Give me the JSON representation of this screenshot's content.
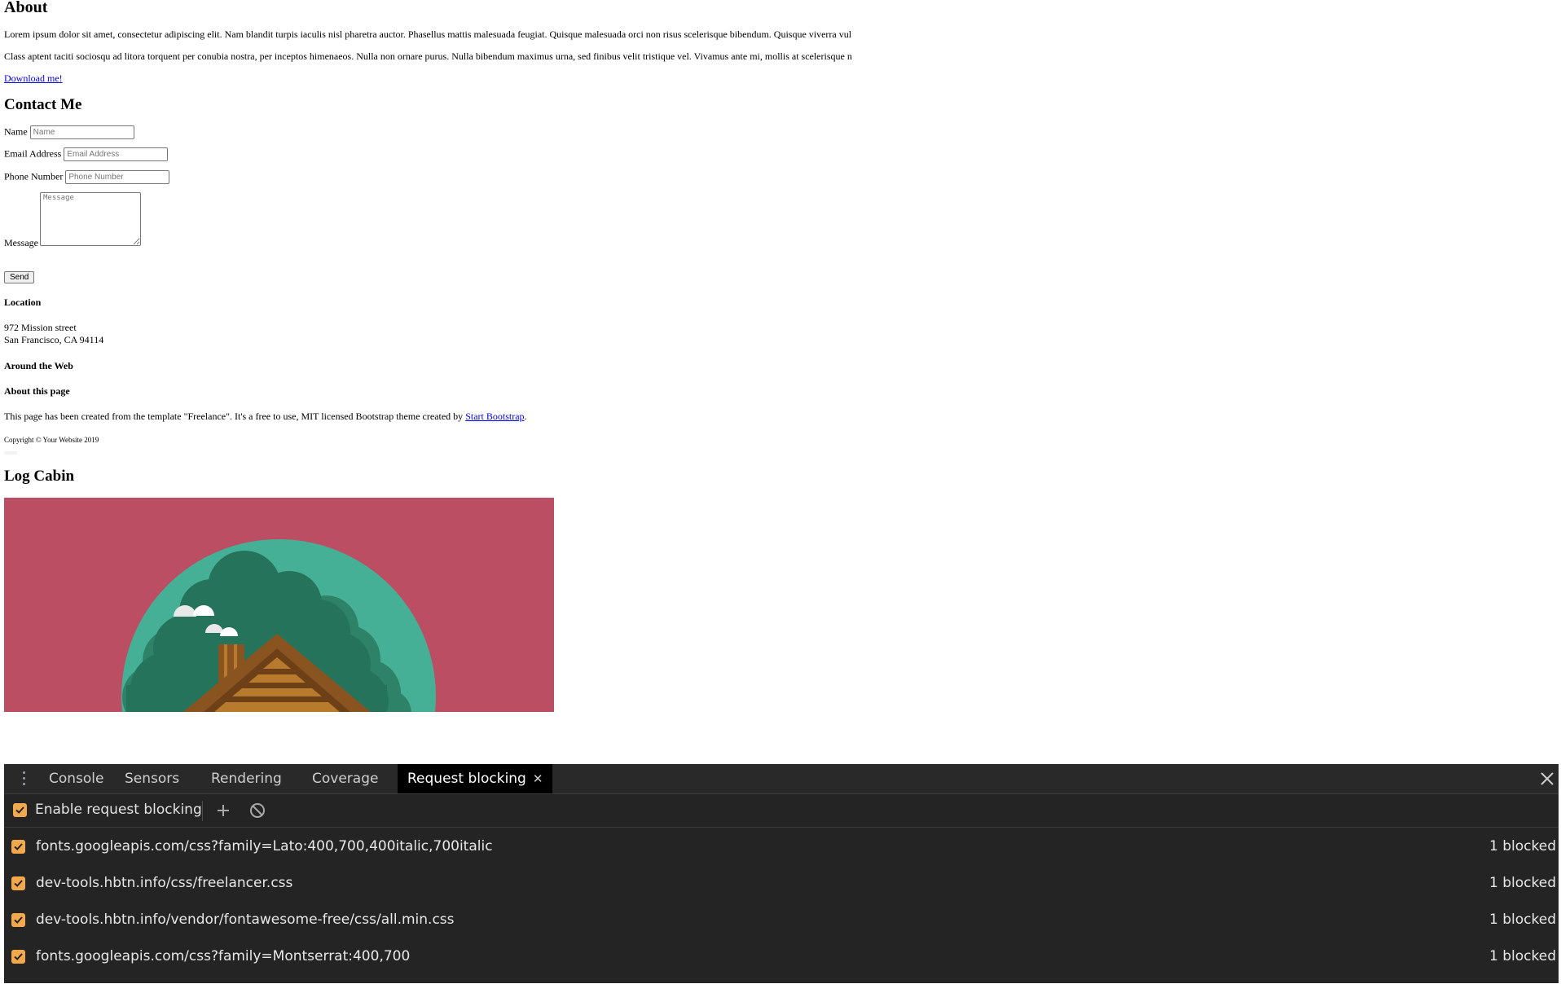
{
  "page": {
    "about": {
      "heading": "About",
      "paragraph_1": "Lorem ipsum dolor sit amet, consectetur adipiscing elit. Nam blandit turpis iaculis nisl pharetra auctor. Phasellus mattis malesuada feugiat. Quisque malesuada orci non risus scelerisque bibendum. Quisque viverra vul",
      "paragraph_2": "Class aptent taciti sociosqu ad litora torquent per conubia nostra, per inceptos himenaeos. Nulla non ornare purus. Nulla bibendum maximus urna, sed finibus velit tristique vel. Vivamus ante mi, mollis at scelerisque n",
      "download_link": "Download me!"
    },
    "contact": {
      "heading": "Contact Me",
      "name_label": "Name",
      "name_placeholder": "Name",
      "email_label": "Email Address",
      "email_placeholder": "Email Address",
      "phone_label": "Phone Number",
      "phone_placeholder": "Phone Number",
      "message_label": "Message",
      "message_placeholder": "Message",
      "send_button": "Send"
    },
    "footer": {
      "location_heading": "Location",
      "address_line_1": "972 Mission street",
      "address_line_2": "San Francisco, CA 94114",
      "around_web_heading": "Around the Web",
      "about_page_heading": "About this page",
      "about_page_text": "This page has been created from the template \"Freelance\". It's a free to use, MIT licensed Bootstrap theme created by",
      "about_page_link": "Start Bootstrap",
      "about_page_trailing": ".",
      "copyright": "Copyright © Your Website 2019"
    },
    "portfolio": {
      "heading": "Log Cabin",
      "image_colors": {
        "background": "#bb4e63",
        "circle": "#45b096",
        "trees_dark": "#26735c",
        "trees_mid": "#2e8268",
        "roof": "#8a5420",
        "roof_light": "#b87a2c",
        "smoke": "#ffffff"
      }
    }
  },
  "devtools": {
    "tabs": [
      {
        "label": "Console"
      },
      {
        "label": "Sensors"
      },
      {
        "label": "Rendering"
      },
      {
        "label": "Coverage"
      },
      {
        "label": "Request blocking",
        "active": true
      }
    ],
    "toolbar": {
      "enable_label": "Enable request blocking",
      "enabled": true,
      "add_icon": "plus-icon",
      "clear_icon": "block-icon"
    },
    "rules": [
      {
        "pattern": "fonts.googleapis.com/css?family=Lato:400,700,400italic,700italic",
        "count": "1 blocked",
        "enabled": true
      },
      {
        "pattern": "dev-tools.hbtn.info/css/freelancer.css",
        "count": "1 blocked",
        "enabled": true
      },
      {
        "pattern": "dev-tools.hbtn.info/vendor/fontawesome-free/css/all.min.css",
        "count": "1 blocked",
        "enabled": true
      },
      {
        "pattern": "fonts.googleapis.com/css?family=Montserrat:400,700",
        "count": "1 blocked",
        "enabled": true
      }
    ],
    "colors": {
      "background": "#242424",
      "checkbox_accent": "#f2a84c",
      "active_tab": "#000000"
    }
  }
}
